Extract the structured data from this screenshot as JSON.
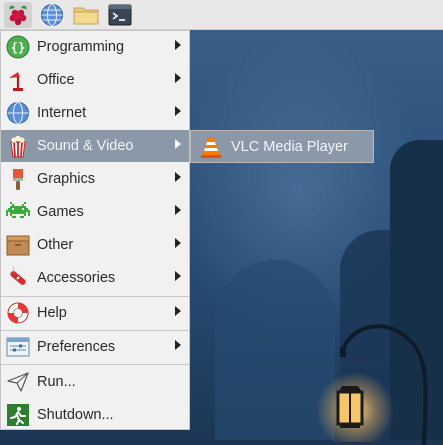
{
  "menu": {
    "items": [
      {
        "label": "Programming"
      },
      {
        "label": "Office"
      },
      {
        "label": "Internet"
      },
      {
        "label": "Sound & Video"
      },
      {
        "label": "Graphics"
      },
      {
        "label": "Games"
      },
      {
        "label": "Other"
      },
      {
        "label": "Accessories"
      },
      {
        "label": "Help"
      },
      {
        "label": "Preferences"
      },
      {
        "label": "Run..."
      },
      {
        "label": "Shutdown..."
      }
    ]
  },
  "submenu": {
    "items": [
      {
        "label": "VLC Media Player"
      }
    ]
  },
  "colors": {
    "highlight": "#8a98a8",
    "menu_bg": "#f1f1f1",
    "panel_bg": "#e8e8e8"
  }
}
